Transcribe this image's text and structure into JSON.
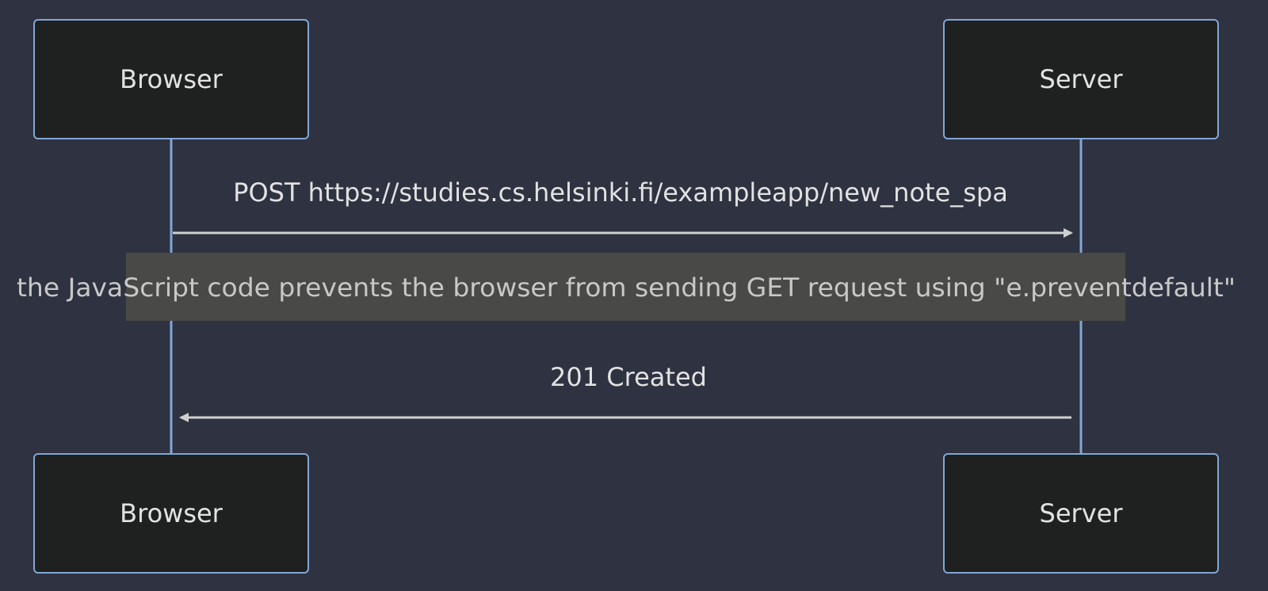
{
  "participants": [
    {
      "id": "browser",
      "label": "Browser"
    },
    {
      "id": "server",
      "label": "Server"
    }
  ],
  "messages": [
    {
      "from": "browser",
      "to": "server",
      "label": "POST https://studies.cs.helsinki.fi/exampleapp/new_note_spa"
    },
    {
      "from": "server",
      "to": "browser",
      "label": "201 Created"
    }
  ],
  "note": {
    "text": "the JavaScript code prevents the browser from sending GET request using \"e.preventdefault\""
  },
  "colors": {
    "background": "#2f3240",
    "participant_fill": "#1f2020",
    "participant_border": "#81a7d6",
    "lifeline": "#81a7d6",
    "arrow": "#d0d0d0",
    "text": "#e2e2e2",
    "note_fill": "#494a48",
    "note_text": "#c8c8c8"
  }
}
